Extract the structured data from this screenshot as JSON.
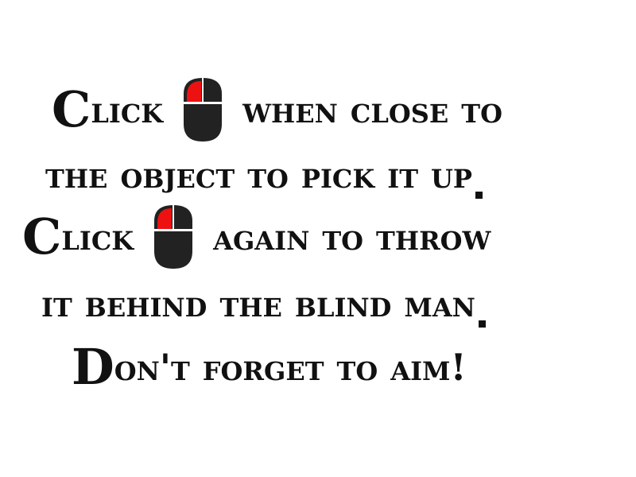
{
  "instructions": {
    "line1": {
      "cap": "C",
      "pre": "lick",
      "post": "when close to"
    },
    "line2": {
      "text": "the object to pick it up"
    },
    "line3": {
      "cap": "C",
      "pre": "lick",
      "post": "again to throw"
    },
    "line4": {
      "text": "it behind the blind man"
    },
    "line5": {
      "cap": "D",
      "rest": "on't forget to aim!"
    }
  },
  "icons": {
    "mouse": "mouse-left-click-icon",
    "body_color": "#222222",
    "highlight_color": "#ee1111"
  }
}
